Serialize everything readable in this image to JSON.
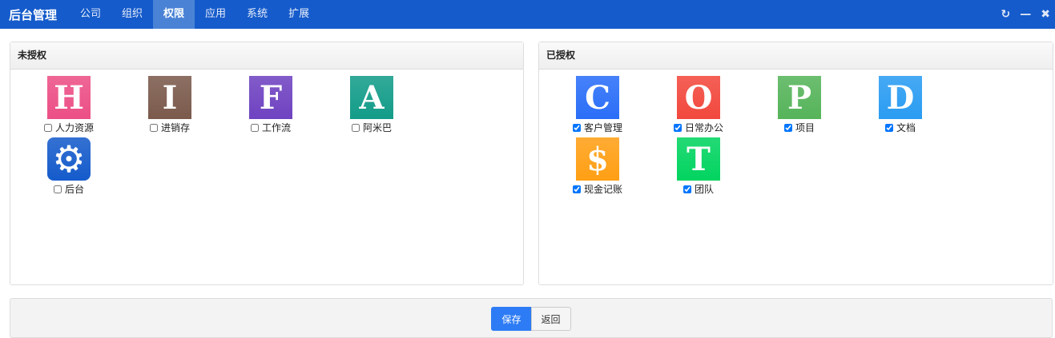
{
  "nav": {
    "brand": "后台管理",
    "tabs": [
      {
        "label": "公司"
      },
      {
        "label": "组织"
      },
      {
        "label": "权限",
        "active": true
      },
      {
        "label": "应用"
      },
      {
        "label": "系统"
      },
      {
        "label": "扩展"
      }
    ],
    "controls": {
      "refresh": "↻",
      "minimize": "—",
      "close": "✖"
    }
  },
  "unauthorized": {
    "title": "未授权",
    "items": [
      {
        "label": "人力资源",
        "letter": "H",
        "color": "#ec4f85",
        "checked": false
      },
      {
        "label": "进销存",
        "letter": "I",
        "color": "#7b5a4c",
        "checked": false
      },
      {
        "label": "工作流",
        "letter": "F",
        "color": "#6f42c1",
        "checked": false
      },
      {
        "label": "阿米巴",
        "letter": "A",
        "color": "#139c89",
        "checked": false
      },
      {
        "label": "后台",
        "letter": "⚙",
        "color": "#155bcb",
        "checked": false
      }
    ]
  },
  "authorized": {
    "title": "已授权",
    "items": [
      {
        "label": "客户管理",
        "letter": "C",
        "color": "#2a6ef8",
        "checked": true
      },
      {
        "label": "日常办公",
        "letter": "O",
        "color": "#f2483d",
        "checked": true
      },
      {
        "label": "项目",
        "letter": "P",
        "color": "#56b45a",
        "checked": true
      },
      {
        "label": "文档",
        "letter": "D",
        "color": "#2a9cf2",
        "checked": true
      },
      {
        "label": "现金记账",
        "letter": "$",
        "color": "#ff9f14",
        "checked": true
      },
      {
        "label": "团队",
        "letter": "T",
        "color": "#02d460",
        "checked": true
      }
    ]
  },
  "footer": {
    "save": "保存",
    "back": "返回"
  }
}
